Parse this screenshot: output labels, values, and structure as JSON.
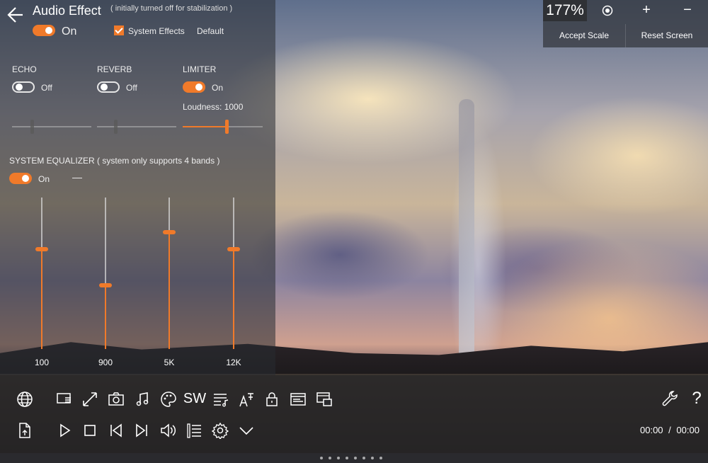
{
  "header": {
    "title": "Audio Effect",
    "subtitle": "( initially turned off for stabilization )",
    "master_toggle": "On",
    "system_effects_label": "System Effects",
    "default_label": "Default"
  },
  "effects": {
    "echo": {
      "label": "ECHO",
      "state": "Off",
      "on": false
    },
    "reverb": {
      "label": "REVERB",
      "state": "Off",
      "on": false
    },
    "limiter": {
      "label": "LIMITER",
      "state": "On",
      "on": true,
      "loudness_label": "Loudness: 1000",
      "loudness_level": 0.55
    }
  },
  "equalizer": {
    "title": "SYSTEM EQUALIZER  ( system only supports 4 bands )",
    "state": "On",
    "collapse_glyph": "—",
    "bands": [
      {
        "label": "100",
        "level": 0.66
      },
      {
        "label": "900",
        "level": 0.42
      },
      {
        "label": "5K",
        "level": 0.77
      },
      {
        "label": "12K",
        "level": 0.66
      }
    ]
  },
  "zoom": {
    "value": "177%",
    "accept_label": "Accept Scale",
    "reset_label": "Reset Screen",
    "plus": "+",
    "minus": "−"
  },
  "toolbar": {
    "subtitle_label": "SW",
    "time_current": "00:00",
    "time_separator": "/",
    "time_total": "00:00",
    "help_glyph": "?"
  },
  "colors": {
    "accent": "#f07a2a"
  }
}
